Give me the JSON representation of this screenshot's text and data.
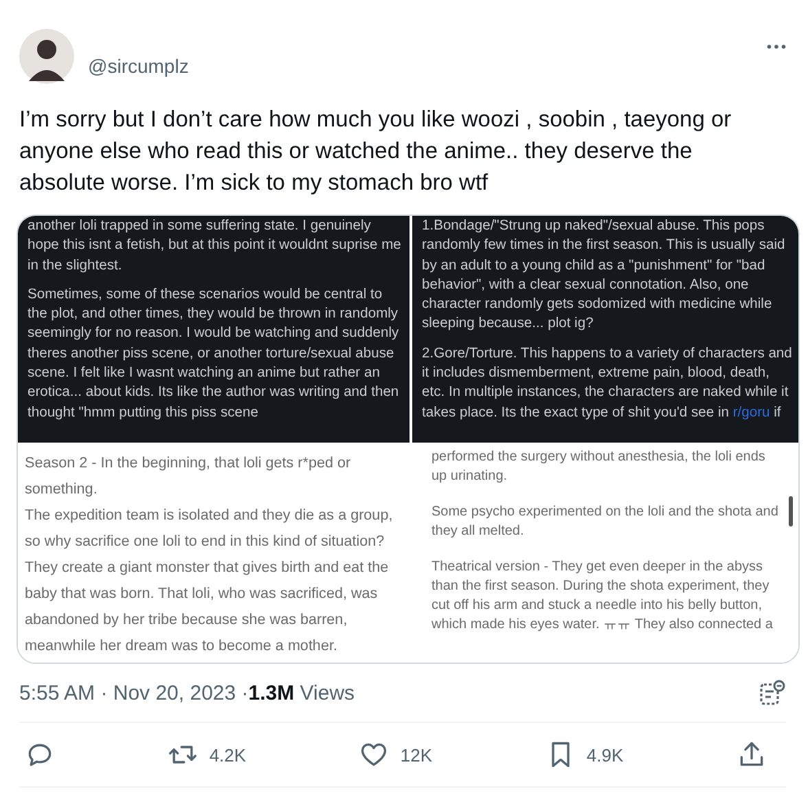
{
  "author": {
    "handle": "@sircumplz"
  },
  "text": "I’m sorry but I don’t care how much you like woozi , soobin , taeyong or anyone else who read this or watched the anime.. they deserve the absolute worse. I’m sick to my stomach bro wtf",
  "media": [
    {
      "kind": "dark",
      "paragraphs": [
        [
          {
            "t": "another loli trapped in some suffering state. I genuinely hope this isnt a fetish, but at this point it wouldnt suprise me in the slightest."
          }
        ],
        [
          {
            "t": "Sometimes, some of these scenarios would be central to the plot, and other times, they would be thrown in randomly seemingly for no reason. I would be watching and suddenly theres another piss scene, or another torture/sexual abuse scene. I felt like I wasnt watching an anime but rather an erotica... about kids. Its like the author was writing and then thought \"hmm putting this piss scene"
          }
        ]
      ]
    },
    {
      "kind": "dark",
      "paragraphs": [
        [
          {
            "t": "1.Bondage/\"Strung up naked\"/sexual abuse. This pops randomly few times in the first season. This is usually said by an adult to a young child as a \"punishment\" for \"bad behavior\", with a clear sexual connotation. Also, one character randomly gets sodomized with medicine while sleeping because... plot ig?"
          }
        ],
        [
          {
            "t": "2.Gore/Torture. This happens to a variety of characters and it includes dismemberment, extreme pain, blood, death, etc. In multiple instances, the characters are naked while it takes place. Its the exact type of shit you'd see in "
          },
          {
            "t": "r/goru",
            "link": true
          },
          {
            "t": " if"
          }
        ]
      ]
    },
    {
      "kind": "light",
      "paragraphs": [
        [
          {
            "t": "Season 2 - In the beginning, that loli gets r*ped or something."
          }
        ],
        [
          {
            "t": "The expedition team is isolated and they die as a group, so why sacrifice one loli to end in this kind of situation? They create a giant monster that gives birth and eat the baby that was born. That loli, who was sacrificed, was abandoned by her tribe because she was barren, meanwhile her dream was to become a mother."
          }
        ]
      ]
    },
    {
      "kind": "light",
      "scroll": true,
      "paragraphs": [
        [
          {
            "t": "performed the surgery without anesthesia, the loli ends up urinating."
          }
        ],
        [
          {
            "t": "Some psycho experimented on the loli and the shota and they all melted."
          }
        ],
        [
          {
            "t": "Theatrical version - They get even deeper in the abyss than the first season. During the shota experiment, they cut off his arm and stuck a needle into his belly button, which made his eyes water. ㅠㅠ They also connected a"
          }
        ]
      ]
    }
  ],
  "meta": {
    "time": "5:55 AM · Nov 20, 2023 ·",
    "views_count": "1.3M",
    "views_label": "Views"
  },
  "actions": [
    {
      "kind": "reply"
    },
    {
      "kind": "retweet",
      "count": "4.2K"
    },
    {
      "kind": "like",
      "count": "12K"
    },
    {
      "kind": "bookmark",
      "count": "4.9K"
    },
    {
      "kind": "share"
    }
  ]
}
